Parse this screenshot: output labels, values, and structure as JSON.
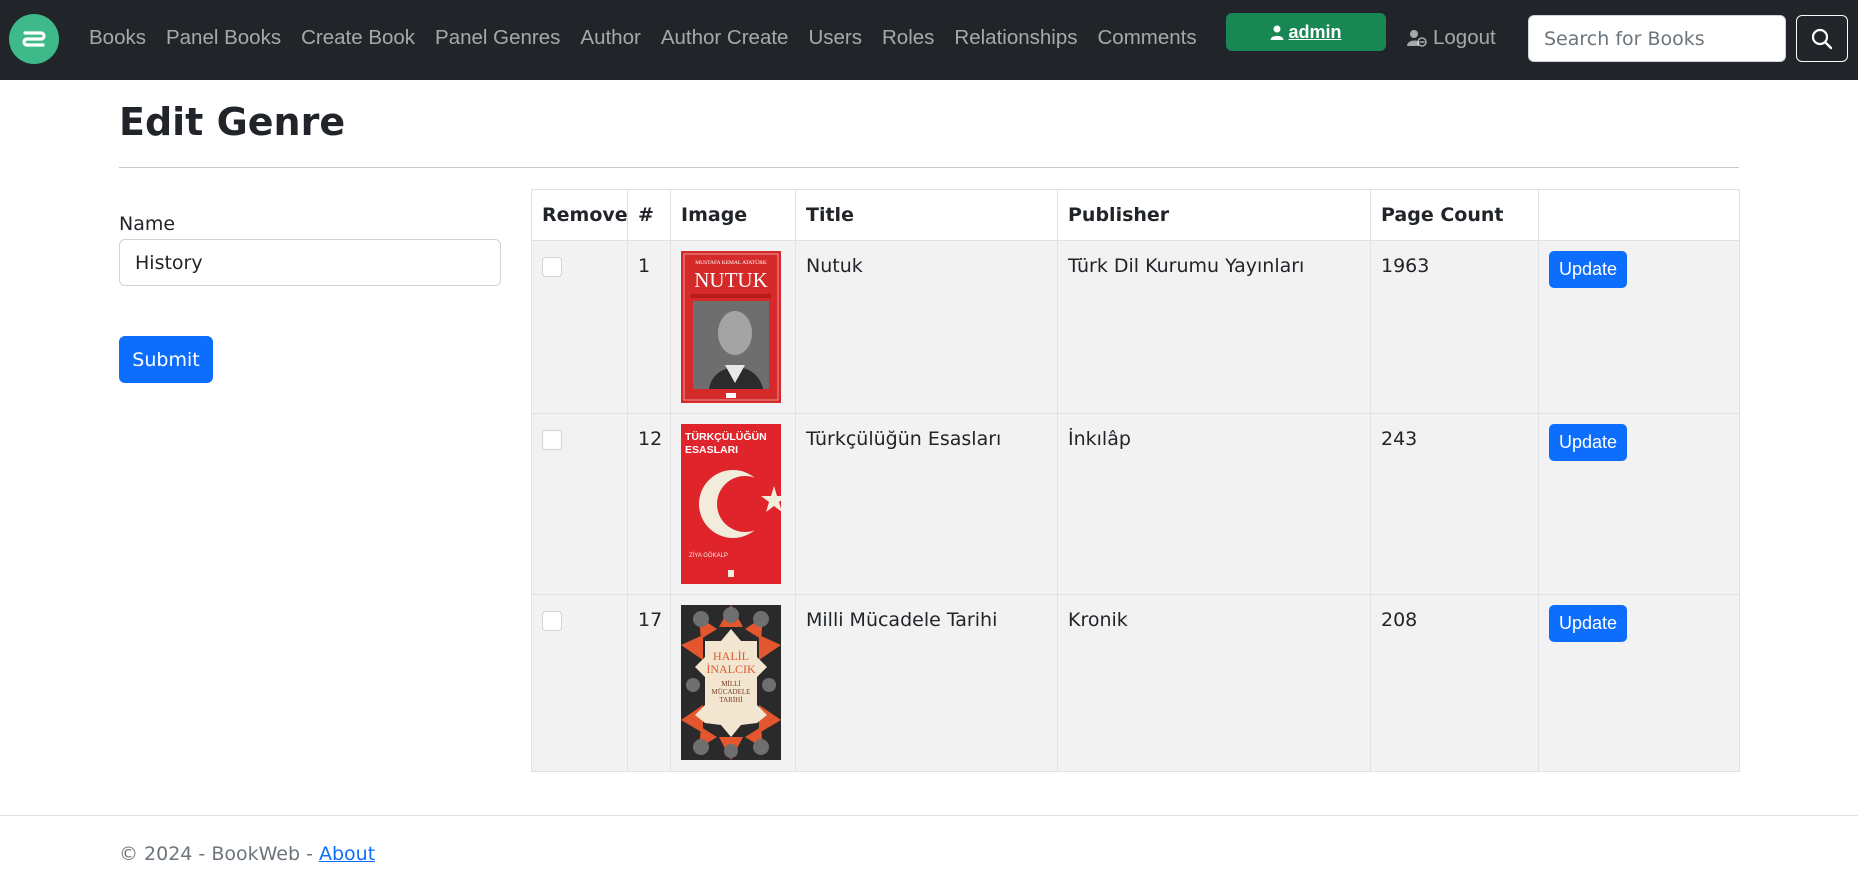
{
  "navbar": {
    "brand_icon": "brand-logo-icon",
    "brand_color": "#3db98a",
    "links": [
      "Books",
      "Panel Books",
      "Create Book",
      "Panel Genres",
      "Author",
      "Author Create",
      "Users",
      "Roles",
      "Relationships",
      "Comments"
    ],
    "admin_label": "admin",
    "logout_label": "Logout",
    "search_placeholder": "Search for Books"
  },
  "page": {
    "title": "Edit Genre",
    "name_label": "Name",
    "name_value": "History",
    "submit_label": "Submit"
  },
  "table": {
    "headers": [
      "Remove",
      "#",
      "Image",
      "Title",
      "Publisher",
      "Page Count",
      ""
    ],
    "rows": [
      {
        "id": "1",
        "title": "Nutuk",
        "publisher": "Türk Dil Kurumu Yayınları",
        "page_count": "1963",
        "update_label": "Update",
        "cover": {
          "top": "MUSTAFA KEMAL ATATÜRK",
          "title": "NUTUK",
          "color": "#d42a2a"
        }
      },
      {
        "id": "12",
        "title": "Türkçülüğün Esasları",
        "publisher": "İnkılâp",
        "page_count": "243",
        "update_label": "Update",
        "cover": {
          "title_line1": "TÜRKÇÜLÜĞÜN",
          "title_line2": "ESASLARI",
          "author": "ZİYA GÖKALP",
          "color": "#e0242b"
        }
      },
      {
        "id": "17",
        "title": "Milli Mücadele Tarihi",
        "publisher": "Kronik",
        "page_count": "208",
        "update_label": "Update",
        "cover": {
          "author_line1": "HALİL",
          "author_line2": "İNALCIK",
          "title_line1": "MİLLİ",
          "title_line2": "MÜCADELE",
          "title_line3": "TARİHİ",
          "color": "#e4572e"
        }
      }
    ]
  },
  "footer": {
    "text": "© 2024 - BookWeb - ",
    "about_label": "About"
  },
  "colors": {
    "navbar_bg": "#212529",
    "primary": "#0d6efd",
    "success": "#198754",
    "row_bg": "#f2f2f2"
  }
}
